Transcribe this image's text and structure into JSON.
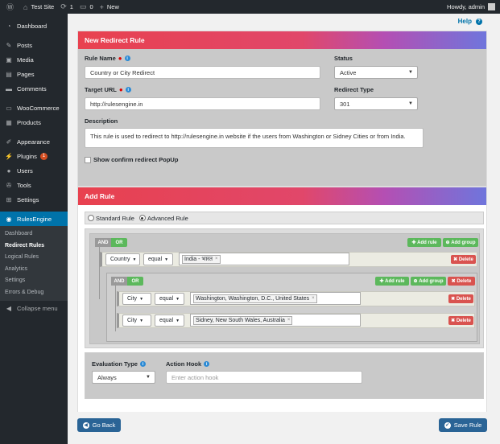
{
  "adminbar": {
    "site_name": "Test Site",
    "updates_count": "1",
    "comments_count": "0",
    "new_label": "New",
    "howdy": "Howdy, admin"
  },
  "sidebar": {
    "items": [
      {
        "label": "Dashboard",
        "icon": "dashboard-icon"
      },
      {
        "label": "Posts",
        "icon": "pin-icon"
      },
      {
        "label": "Media",
        "icon": "media-icon"
      },
      {
        "label": "Pages",
        "icon": "page-icon"
      },
      {
        "label": "Comments",
        "icon": "comment-icon"
      },
      {
        "label": "WooCommerce",
        "icon": "woo-icon"
      },
      {
        "label": "Products",
        "icon": "box-icon"
      },
      {
        "label": "Appearance",
        "icon": "brush-icon"
      },
      {
        "label": "Plugins",
        "icon": "plug-icon",
        "badge": "1"
      },
      {
        "label": "Users",
        "icon": "user-icon"
      },
      {
        "label": "Tools",
        "icon": "wrench-icon"
      },
      {
        "label": "Settings",
        "icon": "settings-icon"
      },
      {
        "label": "RulesEngine",
        "icon": "rules-icon"
      }
    ],
    "submenu": [
      "Dashboard",
      "Redirect Rules",
      "Logical Rules",
      "Analytics",
      "Settings",
      "Errors & Debug"
    ],
    "collapse": "Collapse menu"
  },
  "help": "Help",
  "redirect_panel": {
    "title": "New Redirect Rule",
    "rule_name_label": "Rule Name",
    "rule_name_value": "Country or City Redirect",
    "status_label": "Status",
    "status_value": "Active",
    "target_url_label": "Target URL",
    "target_url_value": "http://rulesengine.in",
    "redirect_type_label": "Redirect Type",
    "redirect_type_value": "301",
    "description_label": "Description",
    "description_value": "This rule is used to redirect to http://rulesengine.in website if the users from Washington or Sidney Cities or from India.",
    "popup_label": "Show confirm redirect PopUp"
  },
  "add_rule_panel": {
    "title": "Add Rule",
    "standard_rule": "Standard Rule",
    "advanced_rule": "Advanced Rule",
    "and": "AND",
    "or": "OR",
    "add_rule": "Add rule",
    "add_group": "Add group",
    "delete": "Delete",
    "rule1": {
      "field": "Country",
      "op": "equal",
      "value": "India - भारत"
    },
    "rule2": {
      "field": "City",
      "op": "equal",
      "value": "Washington, Washington, D.C., United States"
    },
    "rule3": {
      "field": "City",
      "op": "equal",
      "value": "Sidney, New South Wales, Australia"
    },
    "eval_label": "Evaluation Type",
    "eval_value": "Always",
    "hook_label": "Action Hook",
    "hook_placeholder": "Enter action hook"
  },
  "footer": {
    "back": "Go Back",
    "save": "Save Rule"
  }
}
